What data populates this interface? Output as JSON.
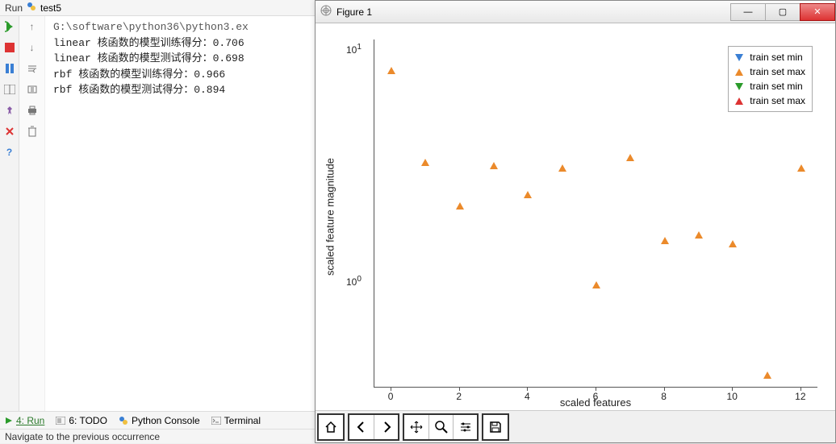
{
  "ide": {
    "header_label": "Run",
    "config_name": "test5",
    "console_path": "G:\\software\\python36\\python3.ex",
    "console_lines": [
      "linear 核函数的模型训练得分：0.706",
      "linear 核函数的模型测试得分：0.698",
      "rbf 核函数的模型训练得分：0.966",
      "rbf 核函数的模型测试得分：0.894"
    ],
    "tabs": {
      "run": "4: Run",
      "todo": "6: TODO",
      "python_console": "Python Console",
      "terminal": "Terminal"
    },
    "status": "Navigate to the previous occurrence"
  },
  "figure": {
    "title": "Figure 1",
    "toolbar_icons": {
      "home": "home-icon",
      "back": "back-icon",
      "forward": "forward-icon",
      "pan": "pan-icon",
      "zoom": "zoom-icon",
      "configure": "configure-icon",
      "save": "save-icon"
    }
  },
  "chart_data": {
    "type": "scatter",
    "xlabel": "scaled features",
    "ylabel": "scaled feature magnitude",
    "xlim": [
      -0.5,
      12.5
    ],
    "ylim_log": [
      -0.4,
      1.1
    ],
    "yscale": "log",
    "y_major_ticks": [
      {
        "label": "10",
        "exp": "0",
        "value": 1.0
      },
      {
        "label": "10",
        "exp": "1",
        "value": 10.0
      }
    ],
    "x_ticks": [
      0,
      2,
      4,
      6,
      8,
      10,
      12
    ],
    "series": [
      {
        "name": "train set min",
        "symbol": "down",
        "color": "#3a7fd4",
        "points": []
      },
      {
        "name": "train set max",
        "symbol": "up",
        "color": "#eb8a2b",
        "points": [
          {
            "x": 0,
            "y": 9.2
          },
          {
            "x": 1,
            "y": 3.7
          },
          {
            "x": 2,
            "y": 2.4
          },
          {
            "x": 3,
            "y": 3.6
          },
          {
            "x": 4,
            "y": 2.7
          },
          {
            "x": 5,
            "y": 3.5
          },
          {
            "x": 6,
            "y": 1.1
          },
          {
            "x": 7,
            "y": 3.9
          },
          {
            "x": 8,
            "y": 1.7
          },
          {
            "x": 9,
            "y": 1.8
          },
          {
            "x": 10,
            "y": 1.65
          },
          {
            "x": 11,
            "y": 0.45
          },
          {
            "x": 12,
            "y": 3.5
          }
        ]
      },
      {
        "name": "train set min",
        "symbol": "down",
        "color": "#2b9b2b",
        "points": []
      },
      {
        "name": "train set max",
        "symbol": "up",
        "color": "#d33",
        "points": []
      }
    ],
    "legend": [
      {
        "label": "train set min",
        "color": "#3a7fd4",
        "dir": "down"
      },
      {
        "label": "train set max",
        "color": "#eb8a2b",
        "dir": "up"
      },
      {
        "label": "train set min",
        "color": "#2b9b2b",
        "dir": "down"
      },
      {
        "label": "train set max",
        "color": "#d33",
        "dir": "up"
      }
    ]
  }
}
